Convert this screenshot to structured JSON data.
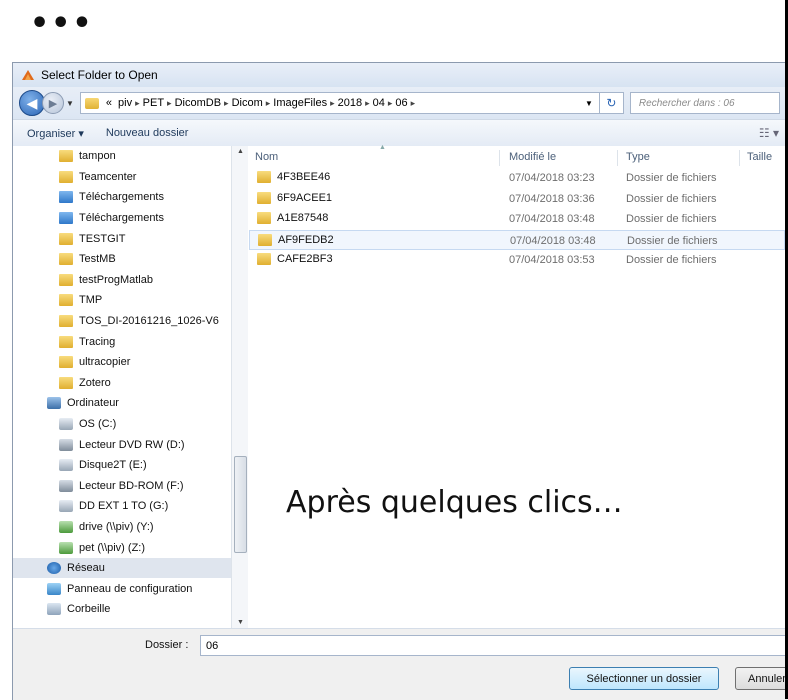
{
  "slide": {
    "ellipsis": "•••",
    "caption": "Après quelques clics…"
  },
  "dialog": {
    "title": "Select Folder to Open",
    "breadcrumb": [
      "«",
      "piv",
      "PET",
      "DicomDB",
      "Dicom",
      "ImageFiles",
      "2018",
      "04",
      "06"
    ],
    "search_placeholder": "Rechercher dans : 06",
    "toolbar": {
      "organize": "Organiser ▾",
      "new_folder": "Nouveau dossier",
      "view_icon": "view-options-icon"
    },
    "nav_items": [
      {
        "label": "tampon",
        "icon": "folder"
      },
      {
        "label": "Teamcenter",
        "icon": "folder"
      },
      {
        "label": "Téléchargements",
        "icon": "dlfolder"
      },
      {
        "label": "Téléchargements",
        "icon": "dlfolder"
      },
      {
        "label": "TESTGIT",
        "icon": "folder"
      },
      {
        "label": "TestMB",
        "icon": "folder"
      },
      {
        "label": "testProgMatlab",
        "icon": "folder"
      },
      {
        "label": "TMP",
        "icon": "folder"
      },
      {
        "label": "TOS_DI-20161216_1026-V6",
        "icon": "folder"
      },
      {
        "label": "Tracing",
        "icon": "folder"
      },
      {
        "label": "ultracopier",
        "icon": "folder"
      },
      {
        "label": "Zotero",
        "icon": "folder"
      },
      {
        "label": "Ordinateur",
        "icon": "computer",
        "level": "top"
      },
      {
        "label": "OS (C:)",
        "icon": "drive"
      },
      {
        "label": "Lecteur DVD RW (D:)",
        "icon": "optical"
      },
      {
        "label": "Disque2T (E:)",
        "icon": "drive"
      },
      {
        "label": "Lecteur BD-ROM (F:)",
        "icon": "optical"
      },
      {
        "label": "DD EXT 1 TO (G:)",
        "icon": "drive"
      },
      {
        "label": "drive (\\\\piv) (Y:)",
        "icon": "netdrive"
      },
      {
        "label": "pet (\\\\piv) (Z:)",
        "icon": "netdrive"
      },
      {
        "label": "Réseau",
        "icon": "network",
        "level": "top",
        "selected": true
      },
      {
        "label": "Panneau de configuration",
        "icon": "controlpanel",
        "level": "top"
      },
      {
        "label": "Corbeille",
        "icon": "recycle",
        "level": "top"
      }
    ],
    "columns": {
      "name": "Nom",
      "date": "Modifié le",
      "type": "Type",
      "size": "Taille"
    },
    "files": [
      {
        "name": "4F3BEE46",
        "date": "07/04/2018 03:23",
        "type": "Dossier de fichiers"
      },
      {
        "name": "6F9ACEE1",
        "date": "07/04/2018 03:36",
        "type": "Dossier de fichiers"
      },
      {
        "name": "A1E87548",
        "date": "07/04/2018 03:48",
        "type": "Dossier de fichiers"
      },
      {
        "name": "AF9FEDB2",
        "date": "07/04/2018 03:48",
        "type": "Dossier de fichiers",
        "hover": true
      },
      {
        "name": "CAFE2BF3",
        "date": "07/04/2018 03:53",
        "type": "Dossier de fichiers"
      }
    ],
    "folder_label": "Dossier :",
    "folder_value": "06",
    "select_button": "Sélectionner un dossier",
    "cancel_button": "Annuler"
  }
}
